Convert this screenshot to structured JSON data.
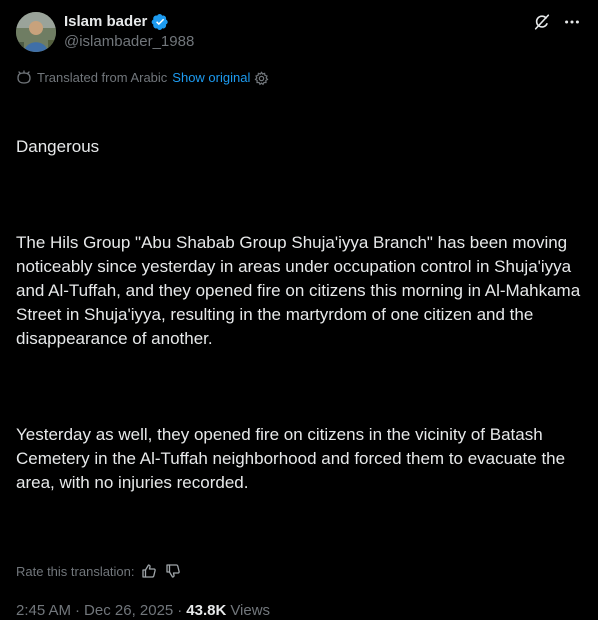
{
  "author": {
    "display_name": "Islam bader",
    "handle": "@islambader_1988",
    "verified": true
  },
  "translation": {
    "label": "Translated from Arabic",
    "show_original": "Show original"
  },
  "post": {
    "paragraphs": [
      "Dangerous",
      "The Hils Group \"Abu Shabab Group Shuja'iyya Branch\" has been moving noticeably since yesterday in areas under occupation control in Shuja'iyya and Al-Tuffah, and they opened fire on citizens this morning in Al-Mahkama Street in Shuja'iyya, resulting in the martyrdom of one citizen and the disappearance of another.",
      "Yesterday as well, they opened fire on citizens in the vicinity of Batash Cemetery in the Al-Tuffah neighborhood and forced them to evacuate the area, with no injuries recorded."
    ]
  },
  "rating": {
    "label": "Rate this translation:"
  },
  "meta": {
    "time": "2:45 AM",
    "separator": "·",
    "date": "Dec 26, 2025",
    "views_count": "43.8K",
    "views_label": "Views"
  },
  "icons": {
    "verified": "verified-badge-icon",
    "grok": "grok-icon",
    "more": "more-icon",
    "translate": "translate-icon",
    "gear": "gear-icon",
    "thumbs_up": "thumbs-up-icon",
    "thumbs_down": "thumbs-down-icon"
  },
  "colors": {
    "background": "#000000",
    "text": "#e7e9ea",
    "secondary": "#71767b",
    "accent": "#1d9bf0"
  }
}
